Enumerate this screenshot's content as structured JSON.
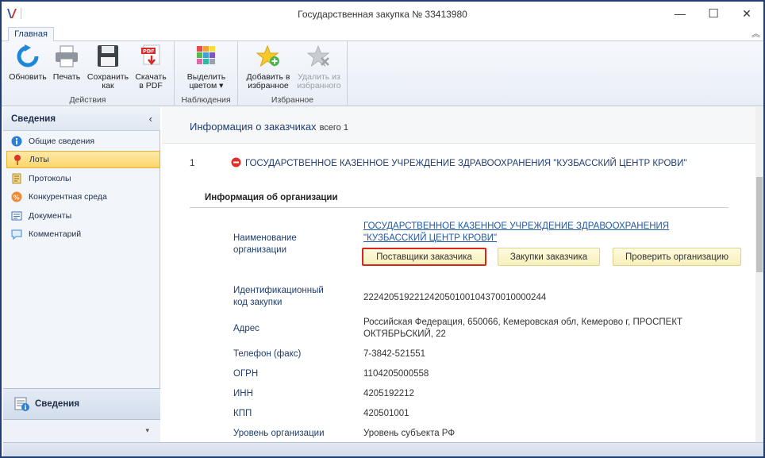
{
  "window": {
    "title": "Государственная закупка № 33413980",
    "minimize": "—",
    "maximize": "☐",
    "close": "✕"
  },
  "ribbon": {
    "tab_main": "Главная",
    "collapse_glyph": "︽",
    "groups": {
      "actions": {
        "label": "Действия",
        "refresh": "Обновить",
        "print": "Печать",
        "save_as_line1": "Сохранить",
        "save_as_line2": "как",
        "download_pdf_line1": "Скачать",
        "download_pdf_line2": "в PDF"
      },
      "observations": {
        "label": "Наблюдения",
        "highlight_line1": "Выделить",
        "highlight_line2": "цветом ▾"
      },
      "favorites": {
        "label": "Избранное",
        "add_line1": "Добавить в",
        "add_line2": "избранное",
        "remove_line1": "Удалить из",
        "remove_line2": "избранного"
      }
    }
  },
  "sidebar": {
    "header": "Сведения",
    "collapse_glyph": "‹",
    "items": [
      {
        "label": "Общие сведения",
        "icon": "info-icon",
        "active": false
      },
      {
        "label": "Лоты",
        "icon": "lot-icon",
        "active": true
      },
      {
        "label": "Протоколы",
        "icon": "protocol-icon",
        "active": false
      },
      {
        "label": "Конкурентная среда",
        "icon": "competition-icon",
        "active": false
      },
      {
        "label": "Документы",
        "icon": "documents-icon",
        "active": false
      },
      {
        "label": "Комментарий",
        "icon": "comment-icon",
        "active": false
      }
    ],
    "bottom_section": "Сведения",
    "footer_arrow": "▾"
  },
  "content": {
    "section_title": "Информация о заказчиках",
    "section_count": "всего 1",
    "customer_number": "1",
    "customer_name": "ГОСУДАРСТВЕННОЕ КАЗЕННОЕ УЧРЕЖДЕНИЕ ЗДРАВООХРАНЕНИЯ \"КУЗБАССКИЙ ЦЕНТР КРОВИ\"",
    "org_info_title": "Информация об организации",
    "fields": {
      "org_name_label_line1": "Наименование",
      "org_name_label_line2": "организации",
      "org_name_value_line1": "ГОСУДАРСТВЕННОЕ КАЗЕННОЕ УЧРЕЖДЕНИЕ ЗДРАВООХРАНЕНИЯ",
      "org_name_value_line2": "\"КУЗБАССКИЙ ЦЕНТР КРОВИ\"",
      "ikz_label_line1": "Идентификационный",
      "ikz_label_line2": "код закупки",
      "ikz_value": "222420519221242050100104370010000244",
      "address_label": "Адрес",
      "address_value_line1": "Российская Федерация, 650066, Кемеровская обл, Кемерово г, ПРОСПЕКТ",
      "address_value_line2": "ОКТЯБРЬСКИЙ, 22",
      "phone_label": "Телефон (факс)",
      "phone_value": "7-3842-521551",
      "ogrn_label": "ОГРН",
      "ogrn_value": "1104205000558",
      "inn_label": "ИНН",
      "inn_value": "4205192212",
      "kpp_label": "КПП",
      "kpp_value": "420501001",
      "level_label": "Уровень организации",
      "level_value": "Уровень субъекта РФ"
    },
    "buttons": {
      "suppliers": "Поставщики заказчика",
      "purchases": "Закупки заказчика",
      "check_org": "Проверить организацию"
    }
  },
  "colors": {
    "accent": "#1f3d6e",
    "link": "#1f58a8",
    "highlight_border": "#d9261c",
    "active_nav": "#fbd66a"
  }
}
